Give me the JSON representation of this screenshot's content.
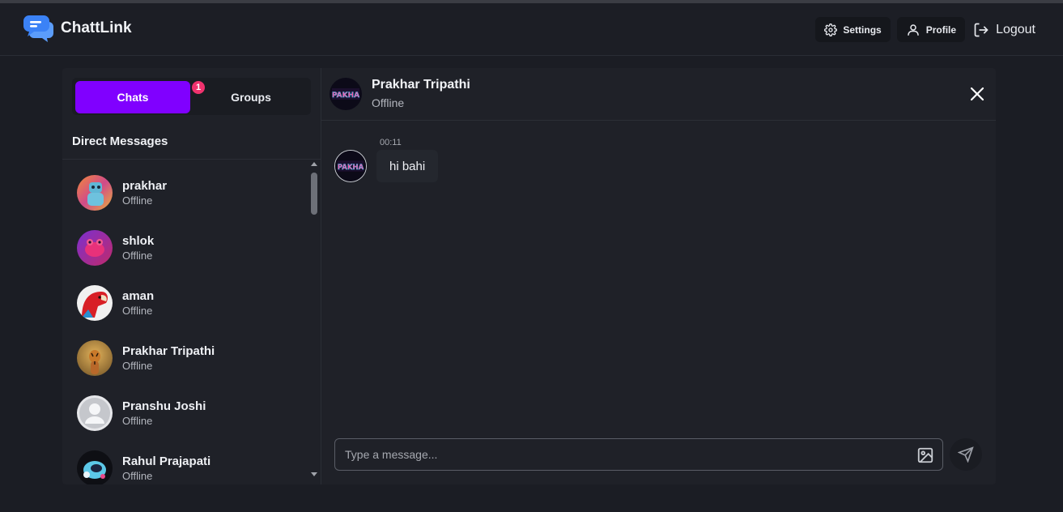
{
  "navbar": {
    "brand": "ChattLink",
    "settings_label": "Settings",
    "profile_label": "Profile",
    "logout_label": "Logout"
  },
  "sidebar": {
    "tabs": [
      {
        "label": "Chats",
        "badge": "1",
        "active": true
      },
      {
        "label": "Groups",
        "active": false
      }
    ],
    "section_title": "Direct Messages",
    "contacts": [
      {
        "name": "prakhar",
        "status": "Offline",
        "avatar_icon": "robot-avatar"
      },
      {
        "name": "shlok",
        "status": "Offline",
        "avatar_icon": "frog-avatar"
      },
      {
        "name": "aman",
        "status": "Offline",
        "avatar_icon": "parrot-avatar"
      },
      {
        "name": "Prakhar Tripathi",
        "status": "Offline",
        "avatar_icon": "tiger-avatar"
      },
      {
        "name": "Pranshu Joshi",
        "status": "Offline",
        "avatar_icon": "default-user-avatar"
      },
      {
        "name": "Rahul Prajapati",
        "status": "Offline",
        "avatar_icon": "astronaut-avatar"
      }
    ]
  },
  "chat": {
    "header": {
      "name": "Prakhar Tripathi",
      "status": "Offline",
      "avatar_text": "PAKHA"
    },
    "messages": [
      {
        "time": "00:11",
        "text": "hi bahi",
        "avatar_text": "PAKHA"
      }
    ],
    "composer": {
      "placeholder": "Type a message..."
    }
  },
  "colors": {
    "accent": "#8000ff",
    "badge": "#f0326e",
    "background": "#1b1d24",
    "panel": "#1f2128",
    "brand_icon": "#3b82f6"
  }
}
